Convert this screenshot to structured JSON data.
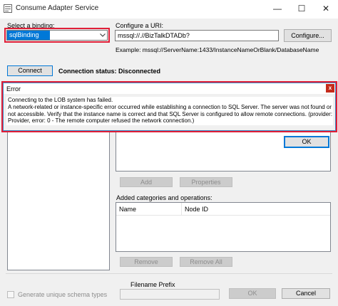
{
  "window": {
    "title": "Consume Adapter Service",
    "minimize_icon": "minimize-icon",
    "maximize_icon": "maximize-icon",
    "close_icon": "close-icon"
  },
  "binding": {
    "label": "Select a binding:",
    "value": "sqlBinding"
  },
  "uri": {
    "label": "Configure a URI:",
    "value": "mssql://.//BizTalkDTADb?",
    "configure_button": "Configure...",
    "example": "Example: mssql://ServerName:1433/InstanceNameOrBlank/DatabaseName"
  },
  "connection": {
    "connect_button": "Connect",
    "status_label": "Connection status:",
    "status_value": "Disconnected"
  },
  "error_dialog": {
    "title": "Error",
    "close_label": "x",
    "message_lines": [
      "Connecting to the LOB system has failed.",
      "A network-related or instance-specific error occurred while establishing a connection to SQL Server. The server was not found or was",
      "not accessible. Verify that the instance name is correct and that SQL Server is configured to allow remote connections. (provider: TCP",
      "Provider, error: 0 - The remote computer refused the network connection.)"
    ],
    "ok_button": "OK"
  },
  "actions": {
    "add_button": "Add",
    "properties_button": "Properties",
    "remove_button": "Remove",
    "remove_all_button": "Remove All"
  },
  "added": {
    "label": "Added categories and operations:",
    "columns": [
      "Name",
      "Node ID"
    ]
  },
  "footer": {
    "filename_prefix_label": "Filename Prefix",
    "filename_prefix_value": "",
    "generate_schema_label": "Generate unique schema types",
    "ok_button": "OK",
    "cancel_button": "Cancel"
  },
  "colors": {
    "highlight": "#e01e37",
    "accent": "#0078d7"
  }
}
